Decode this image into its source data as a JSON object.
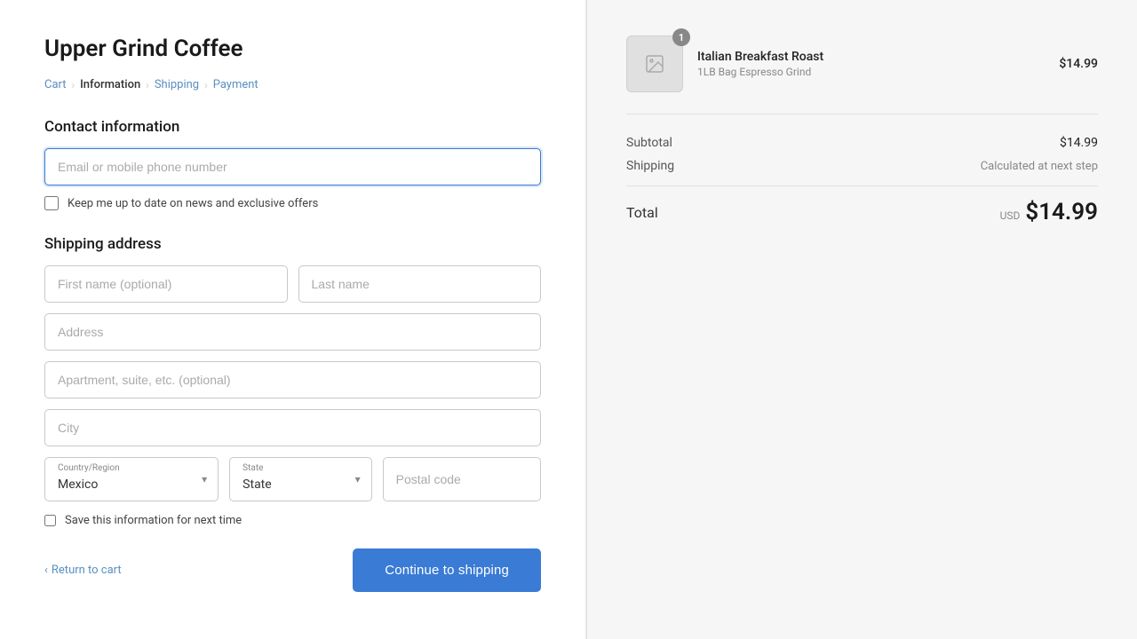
{
  "store": {
    "title": "Upper Grind Coffee"
  },
  "breadcrumb": {
    "items": [
      {
        "label": "Cart",
        "active": false
      },
      {
        "label": "Information",
        "active": true
      },
      {
        "label": "Shipping",
        "active": false
      },
      {
        "label": "Payment",
        "active": false
      }
    ]
  },
  "contact": {
    "section_title": "Contact information",
    "email_placeholder": "Email or mobile phone number",
    "newsletter_label": "Keep me up to date on news and exclusive offers"
  },
  "shipping": {
    "section_title": "Shipping address",
    "first_name_placeholder": "First name (optional)",
    "last_name_placeholder": "Last name",
    "address_placeholder": "Address",
    "apartment_placeholder": "Apartment, suite, etc. (optional)",
    "city_placeholder": "City",
    "country_label": "Country/Region",
    "country_value": "Mexico",
    "state_label": "State",
    "state_value": "State",
    "postal_placeholder": "Postal code",
    "save_label": "Save this information for next time"
  },
  "footer": {
    "return_label": "Return to cart",
    "continue_label": "Continue to shipping"
  },
  "order": {
    "product_name": "Italian Breakfast Roast",
    "product_variant": "1LB Bag Espresso Grind",
    "product_price": "$14.99",
    "badge_count": "1",
    "subtotal_label": "Subtotal",
    "subtotal_value": "$14.99",
    "shipping_label": "Shipping",
    "shipping_value": "Calculated at next step",
    "total_label": "Total",
    "total_currency": "USD",
    "total_amount": "$14.99"
  }
}
